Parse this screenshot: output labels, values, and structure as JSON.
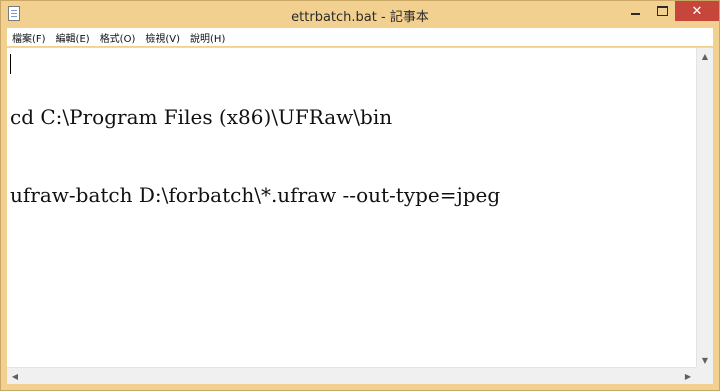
{
  "window": {
    "title": "ettrbatch.bat - 記事本"
  },
  "title_controls": {
    "minimize": "minimize",
    "maximize": "maximize",
    "close": "✕"
  },
  "menu": [
    {
      "label": "檔案(F)"
    },
    {
      "label": "編輯(E)"
    },
    {
      "label": "格式(O)"
    },
    {
      "label": "檢視(V)"
    },
    {
      "label": "說明(H)"
    }
  ],
  "editor": {
    "lines": [
      "cd C:\\Program Files (x86)\\UFRaw\\bin",
      "ufraw-batch D:\\forbatch\\*.ufraw --out-type=jpeg"
    ]
  },
  "scroll": {
    "up": "▲",
    "down": "▼",
    "left": "◀",
    "right": "▶"
  },
  "colors": {
    "titlebar": "#f2d08f",
    "close_button": "#c7463c"
  }
}
